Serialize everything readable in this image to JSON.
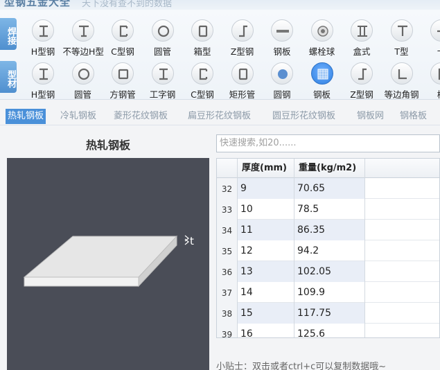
{
  "app": {
    "title": "型钢五金大全",
    "slogan": "天下没有查不到的数据"
  },
  "toolbar": {
    "row1": {
      "category": "焊接",
      "items": [
        {
          "label": "H型钢",
          "icon": "h-beam-icon"
        },
        {
          "label": "不等边H型",
          "icon": "unequal-h-icon"
        },
        {
          "label": "C型钢",
          "icon": "c-channel-icon"
        },
        {
          "label": "圆管",
          "icon": "round-pipe-icon"
        },
        {
          "label": "箱型",
          "icon": "box-section-icon"
        },
        {
          "label": "Z型钢",
          "icon": "z-section-icon"
        },
        {
          "label": "钢板",
          "icon": "steel-plate-icon"
        },
        {
          "label": "螺栓球",
          "icon": "bolt-ball-icon"
        },
        {
          "label": "盒式",
          "icon": "box-type-icon"
        },
        {
          "label": "T型",
          "icon": "t-section-icon"
        },
        {
          "label": "十",
          "icon": "cross-section-icon"
        }
      ]
    },
    "row2": {
      "category": "型材",
      "items": [
        {
          "label": "H型钢",
          "icon": "h-beam-icon"
        },
        {
          "label": "圆管",
          "icon": "round-pipe-icon"
        },
        {
          "label": "方钢管",
          "icon": "square-pipe-icon"
        },
        {
          "label": "工字钢",
          "icon": "i-beam-icon"
        },
        {
          "label": "C型钢",
          "icon": "c-channel-icon"
        },
        {
          "label": "矩形管",
          "icon": "rect-pipe-icon"
        },
        {
          "label": "圆钢",
          "icon": "round-bar-icon"
        },
        {
          "label": "钢板",
          "icon": "steel-plate-icon"
        },
        {
          "label": "Z型钢",
          "icon": "z-section-icon"
        },
        {
          "label": "等边角钢",
          "icon": "angle-steel-icon"
        },
        {
          "label": "槽",
          "icon": "channel-icon"
        }
      ]
    }
  },
  "tabs": [
    "热轧钢板",
    "冷轧钢板",
    "菱形花纹钢板",
    "扁豆形花纹钢板",
    "圆豆形花纹钢板",
    "钢板网",
    "钢格板"
  ],
  "left": {
    "title": "热轧钢板",
    "thickness_label": "t"
  },
  "search": {
    "placeholder": "快速搜索,如20......"
  },
  "table": {
    "columns": [
      "厚度(mm)",
      "重量(kg/m2)"
    ],
    "rows": [
      {
        "n": "32",
        "thickness": "9",
        "weight": "70.65"
      },
      {
        "n": "33",
        "thickness": "10",
        "weight": "78.5"
      },
      {
        "n": "34",
        "thickness": "11",
        "weight": "86.35"
      },
      {
        "n": "35",
        "thickness": "12",
        "weight": "94.2"
      },
      {
        "n": "36",
        "thickness": "13",
        "weight": "102.05"
      },
      {
        "n": "37",
        "thickness": "14",
        "weight": "109.9"
      },
      {
        "n": "38",
        "thickness": "15",
        "weight": "117.75"
      },
      {
        "n": "39",
        "thickness": "16",
        "weight": "125.6"
      }
    ]
  },
  "tip": "小贴士：双击或者ctrl+c可以复制数据哦~",
  "colors": {
    "accent": "#4a90d9",
    "preview_bg": "#4a4d57",
    "alt_cell": "#e9eef7"
  }
}
